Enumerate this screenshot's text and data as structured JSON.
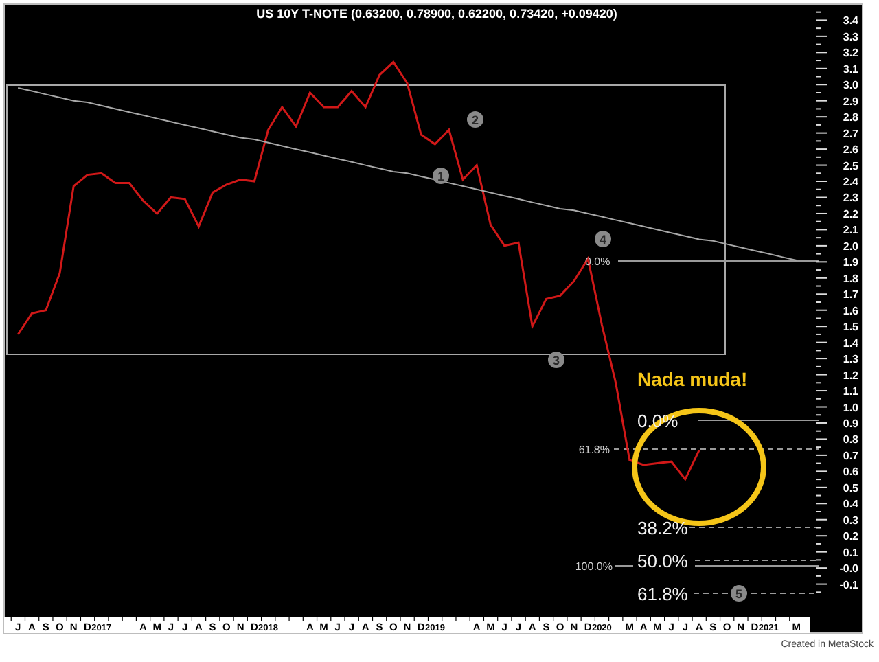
{
  "chart": {
    "chart_data": {
      "type": "line",
      "title": "US 10Y T-NOTE (0.63200, 0.78900, 0.62200, 0.73420, +0.09420)",
      "categories": [
        "J",
        "A",
        "S",
        "O",
        "N",
        "D",
        "2017",
        null,
        null,
        "A",
        "M",
        "J",
        "J",
        "A",
        "S",
        "O",
        "N",
        "D",
        "2018",
        null,
        null,
        "A",
        "M",
        "J",
        "J",
        "A",
        "S",
        "O",
        "N",
        "D",
        "2019",
        null,
        null,
        "A",
        "M",
        "J",
        "J",
        "A",
        "S",
        "O",
        "N",
        "D",
        "2020",
        null,
        "M",
        "A",
        "M",
        "J",
        "J",
        "A",
        "S",
        "O",
        "N",
        "D",
        "2021",
        null,
        "M"
      ],
      "series": [
        {
          "color": "#d01818",
          "values": [
            1.45,
            1.58,
            1.6,
            1.83,
            2.37,
            2.44,
            2.45,
            2.39,
            2.39,
            2.28,
            2.2,
            2.3,
            2.29,
            2.12,
            2.33,
            2.38,
            2.41,
            2.4,
            2.72,
            2.86,
            2.74,
            2.95,
            2.86,
            2.86,
            2.96,
            2.86,
            3.06,
            3.14,
            3.01,
            2.69,
            2.63,
            2.72,
            2.41,
            2.5,
            2.13,
            2.0,
            2.02,
            1.5,
            1.67,
            1.69,
            1.78,
            1.92,
            1.51,
            1.15,
            0.67,
            0.64,
            0.65,
            0.66,
            0.55,
            0.73,
            null,
            null,
            null,
            null,
            null,
            null,
            null
          ]
        },
        {
          "color": "#a8a8a8",
          "values": [
            2.98,
            2.96,
            2.94,
            2.92,
            2.9,
            2.89,
            2.87,
            2.85,
            2.83,
            2.81,
            2.79,
            2.77,
            2.75,
            2.73,
            2.71,
            2.69,
            2.67,
            2.66,
            2.64,
            2.62,
            2.6,
            2.58,
            2.56,
            2.54,
            2.52,
            2.5,
            2.48,
            2.46,
            2.45,
            2.43,
            2.41,
            2.39,
            2.37,
            2.35,
            2.33,
            2.31,
            2.29,
            2.27,
            2.25,
            2.23,
            2.22,
            2.2,
            2.18,
            2.16,
            2.14,
            2.12,
            2.1,
            2.08,
            2.06,
            2.04,
            2.03,
            2.01,
            1.99,
            1.97,
            1.95,
            1.93,
            1.91
          ]
        }
      ],
      "ylim": [
        -0.1,
        3.4
      ],
      "yticks": [
        3.4,
        3.3,
        3.2,
        3.1,
        {
          "value": 3,
          "label": "3.0"
        },
        2.9,
        2.8,
        2.7,
        2.6,
        2.5,
        2.4,
        2.3,
        2.2,
        2.1,
        {
          "value": 2,
          "label": "2.0"
        },
        1.9,
        1.8,
        1.7,
        1.6,
        1.5,
        1.4,
        1.3,
        1.2,
        1.1,
        {
          "value": 1,
          "label": "1.0"
        },
        0.9,
        0.8,
        0.7,
        0.6,
        0.5,
        0.4,
        0.3,
        0.2,
        0.1,
        {
          "value": 0,
          "label": "-0.0"
        },
        -0.1
      ]
    },
    "overlays": [
      {
        "kind": "wave",
        "text": "2"
      },
      {
        "kind": "wave",
        "text": "1"
      },
      {
        "kind": "wave",
        "text": "4"
      },
      {
        "kind": "fib_small",
        "text": "0.0%"
      },
      {
        "kind": "wave",
        "text": "3"
      },
      {
        "kind": "callout",
        "text": "Nada muda!"
      },
      {
        "kind": "fib_large",
        "text": "0.0%"
      },
      {
        "kind": "fib_small",
        "text": "61.8%"
      },
      {
        "kind": "fib_large",
        "text": "38.2%"
      },
      {
        "kind": "fib_large",
        "text": "50.0%"
      },
      {
        "kind": "fib_small",
        "text": "100.0%"
      },
      {
        "kind": "fib_large",
        "text": "61.8%"
      },
      {
        "kind": "wave",
        "text": "5"
      }
    ]
  },
  "footer": {
    "credit": "Created in MetaStock"
  }
}
